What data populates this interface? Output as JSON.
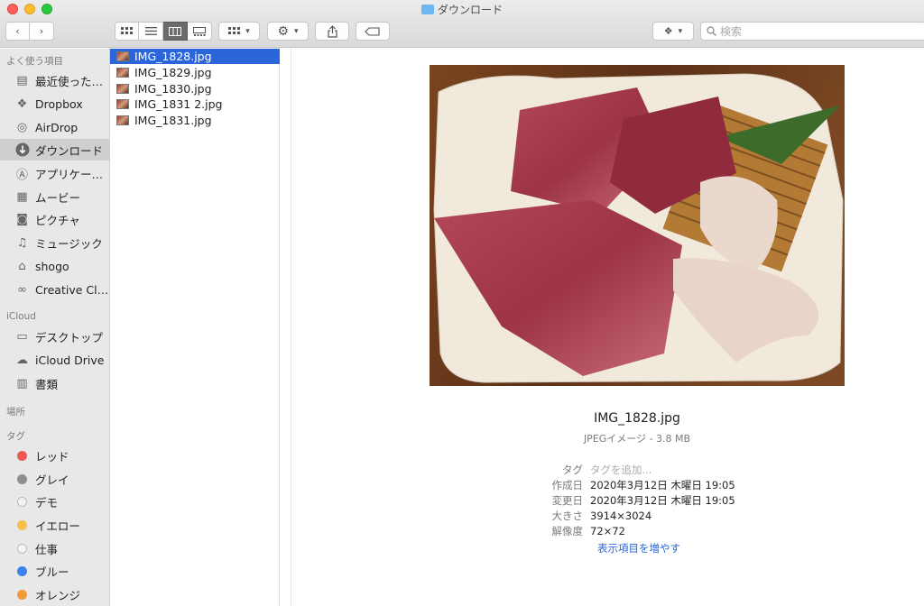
{
  "window": {
    "title": "ダウンロード"
  },
  "toolbar": {
    "back_icon": "chevron-left-icon",
    "forward_icon": "chevron-right-icon",
    "view_modes": [
      "icon-view-icon",
      "list-view-icon",
      "column-view-icon",
      "gallery-view-icon"
    ],
    "active_view": "column-view-icon",
    "search_placeholder": "検索"
  },
  "sidebar": {
    "favorites_header": "よく使う項目",
    "favorites": [
      {
        "label": "最近使った…",
        "icon": "recents-icon"
      },
      {
        "label": "Dropbox",
        "icon": "dropbox-icon"
      },
      {
        "label": "AirDrop",
        "icon": "airdrop-icon"
      },
      {
        "label": "ダウンロード",
        "icon": "downloads-icon",
        "selected": true
      },
      {
        "label": "アプリケー…",
        "icon": "applications-icon"
      },
      {
        "label": "ムービー",
        "icon": "movies-icon"
      },
      {
        "label": "ピクチャ",
        "icon": "pictures-icon"
      },
      {
        "label": "ミュージック",
        "icon": "music-icon"
      },
      {
        "label": "shogo",
        "icon": "home-icon"
      },
      {
        "label": "Creative Cl…",
        "icon": "creative-cloud-icon"
      }
    ],
    "icloud_header": "iCloud",
    "icloud": [
      {
        "label": "デスクトップ",
        "icon": "desktop-icon"
      },
      {
        "label": "iCloud Drive",
        "icon": "icloud-drive-icon"
      },
      {
        "label": "書類",
        "icon": "documents-icon"
      }
    ],
    "places_header": "場所",
    "tags_header": "タグ",
    "tags": [
      {
        "label": "レッド",
        "color": "#ee5a50"
      },
      {
        "label": "グレイ",
        "color": "#8e8e8e"
      },
      {
        "label": "デモ",
        "color": "#e4e4e4"
      },
      {
        "label": "イエロー",
        "color": "#f6c14a"
      },
      {
        "label": "仕事",
        "color": "#e4e4e4"
      },
      {
        "label": "ブルー",
        "color": "#3b82f0"
      },
      {
        "label": "オレンジ",
        "color": "#f09a3c"
      }
    ]
  },
  "files": [
    {
      "name": "IMG_1828.jpg",
      "selected": true
    },
    {
      "name": "IMG_1829.jpg"
    },
    {
      "name": "IMG_1830.jpg"
    },
    {
      "name": "IMG_1831 2.jpg"
    },
    {
      "name": "IMG_1831.jpg"
    }
  ],
  "preview": {
    "name": "IMG_1828.jpg",
    "kind": "JPEGイメージ - 3.8 MB",
    "meta": [
      {
        "key": "タグ",
        "value": "タグを追加...",
        "placeholder": true
      },
      {
        "key": "作成日",
        "value": "2020年3月12日 木曜日 19:05"
      },
      {
        "key": "変更日",
        "value": "2020年3月12日 木曜日 19:05"
      },
      {
        "key": "大きさ",
        "value": "3914×3024"
      },
      {
        "key": "解像度",
        "value": "72×72"
      }
    ],
    "more_link": "表示項目を増やす"
  }
}
